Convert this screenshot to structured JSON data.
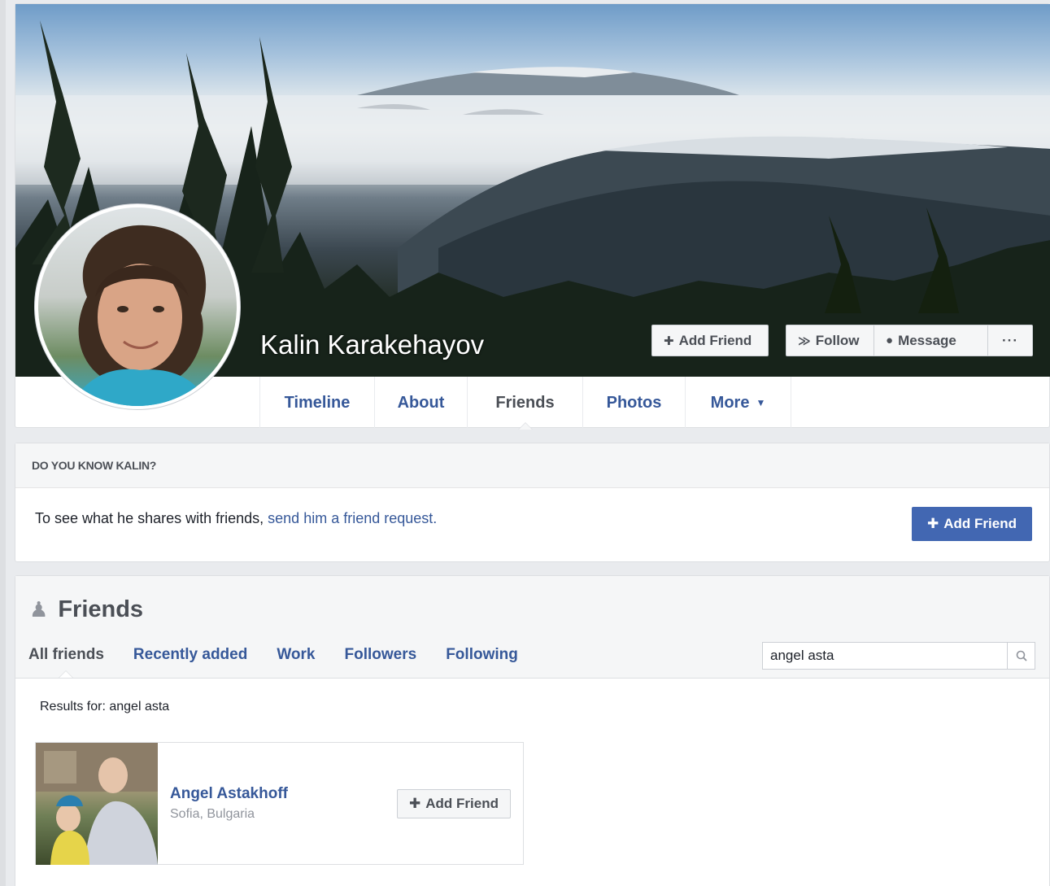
{
  "profile": {
    "name": "Kalin Karakehayov"
  },
  "cover_actions": {
    "add_friend": "Add Friend",
    "follow": "Follow",
    "message": "Message",
    "more": "···"
  },
  "profile_tabs": [
    {
      "label": "Timeline"
    },
    {
      "label": "About"
    },
    {
      "label": "Friends"
    },
    {
      "label": "Photos"
    },
    {
      "label": "More"
    }
  ],
  "know": {
    "heading": "DO YOU KNOW KALIN?",
    "text": "To see what he shares with friends, ",
    "link": "send him a friend request.",
    "button": "Add Friend"
  },
  "friends": {
    "title": "Friends",
    "tabs": [
      {
        "label": "All friends"
      },
      {
        "label": "Recently added"
      },
      {
        "label": "Work"
      },
      {
        "label": "Followers"
      },
      {
        "label": "Following"
      }
    ],
    "search_value": "angel asta",
    "results_label": "Results for: angel asta",
    "items": [
      {
        "name": "Angel Astakhoff",
        "location": "Sofia, Bulgaria",
        "button": "Add Friend"
      }
    ]
  },
  "colors": {
    "link": "#365899",
    "primary_button": "#4267b2",
    "page_bg": "#e9ebee"
  }
}
